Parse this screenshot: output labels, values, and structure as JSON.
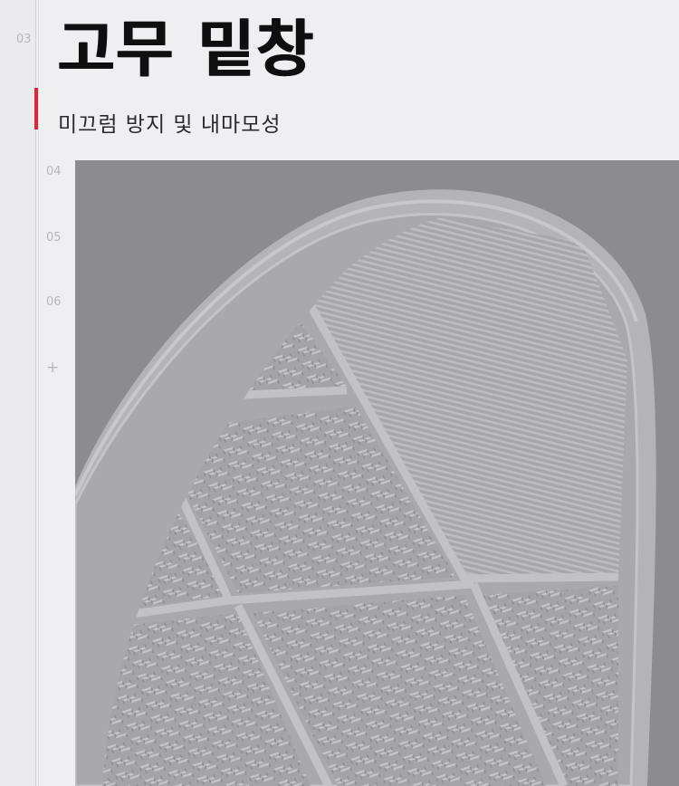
{
  "nav": {
    "current": "03",
    "items": [
      "04",
      "05",
      "06"
    ],
    "more": "+"
  },
  "header": {
    "title": "고무 밑창",
    "subtitle": "미끄럼 방지 및 내마모성"
  },
  "colors": {
    "accent": "#d4293b",
    "photo_background": "#8c8c90",
    "sole": "#b4b4b8"
  },
  "photo": {
    "icon": "rubber-sole-photo"
  }
}
